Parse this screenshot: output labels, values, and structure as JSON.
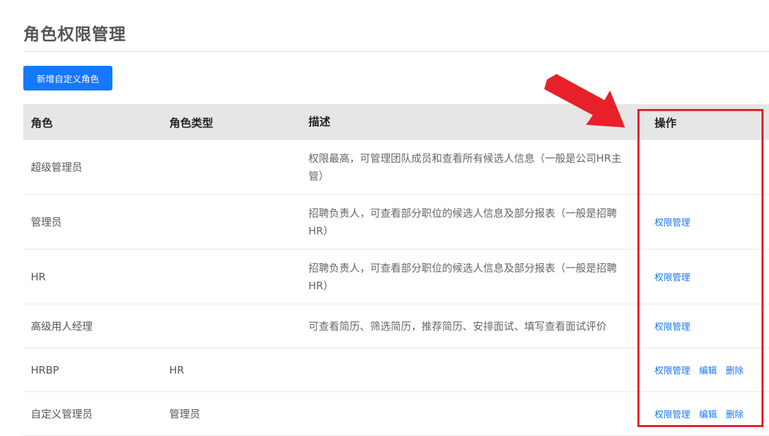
{
  "page_title": "角色权限管理",
  "add_button_label": "新增自定义角色",
  "table": {
    "headers": {
      "role": "角色",
      "role_type": "角色类型",
      "description": "描述",
      "actions": "操作"
    },
    "rows": [
      {
        "role": "超级管理员",
        "role_type": "",
        "desc_line1": "权限最高，可管理团队成员和查看所有候选人信息（一般是公司HR主",
        "desc_line2": "管）",
        "action_permission": "",
        "action_edit": "",
        "action_delete": ""
      },
      {
        "role": "管理员",
        "role_type": "",
        "desc_line1": "招聘负责人，可查看部分职位的候选人信息及部分报表（一般是招聘",
        "desc_line2": "HR）",
        "action_permission": "权限管理",
        "action_edit": "",
        "action_delete": ""
      },
      {
        "role": "HR",
        "role_type": "",
        "desc_line1": "招聘负责人，可查看部分职位的候选人信息及部分报表（一般是招聘",
        "desc_line2": "HR）",
        "action_permission": "权限管理",
        "action_edit": "",
        "action_delete": ""
      },
      {
        "role": "高级用人经理",
        "role_type": "",
        "desc_line1": "可查看简历、筛选简历，推荐简历、安排面试、填写查看面试评价",
        "desc_line2": "",
        "action_permission": "权限管理",
        "action_edit": "",
        "action_delete": ""
      },
      {
        "role": "HRBP",
        "role_type": "HR",
        "desc_line1": "",
        "desc_line2": "",
        "action_permission": "权限管理",
        "action_edit": "编辑",
        "action_delete": "删除"
      },
      {
        "role": "自定义管理员",
        "role_type": "管理员",
        "desc_line1": "",
        "desc_line2": "",
        "action_permission": "权限管理",
        "action_edit": "编辑",
        "action_delete": "删除"
      }
    ]
  },
  "colors": {
    "accent": "#1677ff",
    "highlight": "#e8202a",
    "header_bg": "#e6e6e6"
  },
  "icons": {
    "annotation_arrow": "arrow-icon"
  }
}
